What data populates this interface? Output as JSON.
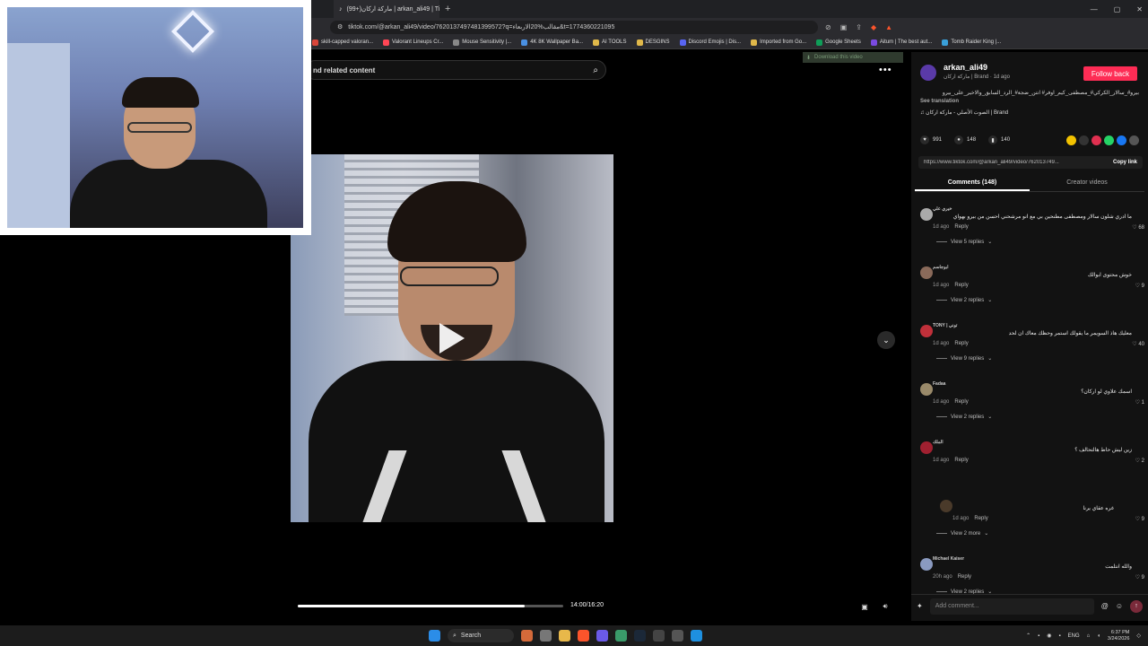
{
  "browser": {
    "tab_title": "(99+)ماركة اركان | arkan_ali49 | TikTok",
    "url": "tiktok.com/@arkan_ali49/video/7620137497481399572?q=مقالب%20الاربعاء&t=1774360221095",
    "new_tab": "+",
    "bookmarks": [
      {
        "label": "skill-capped valoran...",
        "color": "#d9463a"
      },
      {
        "label": "Valorant Lineups Cr...",
        "color": "#ff4655"
      },
      {
        "label": "Mouse Sensitivity |...",
        "color": "#888888"
      },
      {
        "label": "4K 8K Wallpaper Ba...",
        "color": "#4a90e2"
      },
      {
        "label": "AI TOOLS",
        "color": "#e0b84a"
      },
      {
        "label": "DESGINS",
        "color": "#e0b84a"
      },
      {
        "label": "Discord Emojis | Dis...",
        "color": "#5865f2"
      },
      {
        "label": "Imported from Go...",
        "color": "#e0b84a"
      },
      {
        "label": "Google Sheets",
        "color": "#0f9d58"
      },
      {
        "label": "Aitum | The best aut...",
        "color": "#7a4ae0"
      },
      {
        "label": "Tomb Raider King |...",
        "color": "#3aa0d9"
      }
    ]
  },
  "video": {
    "search_label": "nd related content",
    "time": "14:00/16:20",
    "progress_fraction": 0.855,
    "download_badge": "Download this video"
  },
  "post": {
    "author": "arkan_ali49",
    "author_sub": "ماركة اركان | Brand · 1d ago",
    "follow_label": "Follow back",
    "description": "بيرو#_سالار_الكركي#_مصطفى_كيم_اوفر# انتن_ضجة#_الرد_السابق_والاخير_على_بيرو",
    "see_translation": "See translation",
    "music": "الصوت الأصلي - ماركة اركان | Brand",
    "likes": "991",
    "comments_count": "148",
    "saves": "140",
    "link": "https://www.tiktok.com/@arkan_ali49/video/762013749...",
    "copy_link": "Copy link",
    "tabs": [
      "Comments (148)",
      "Creator videos"
    ]
  },
  "comments": [
    {
      "user": "خيري علي",
      "text": "ما ادري شلون سالار ومصطفى مطنحين بي مع انو مرشحني احسن من بيرو بهواي",
      "age": "1d ago",
      "reply": "Reply",
      "likes": "68",
      "view": "View 5 replies",
      "avatar_color": "#aaaaaa",
      "nested": false
    },
    {
      "user": "ابوجاسم",
      "text": "خوش محتوى ابوالك",
      "age": "1d ago",
      "reply": "Reply",
      "likes": "9",
      "view": "View 2 replies",
      "avatar_color": "#8a6a5a",
      "nested": false
    },
    {
      "user": "TONY | توني",
      "text": "معليك هاذ السويمر ما يقولك استمر وحظك معاك ان لحد",
      "age": "1d ago",
      "reply": "Reply",
      "likes": "40",
      "view": "View 9 replies",
      "avatar_color": "#c0303a",
      "nested": false
    },
    {
      "user": "Fadaa",
      "text": "اسمك علاوي لو اركان؟",
      "age": "1d ago",
      "reply": "Reply",
      "likes": "1",
      "view": "View 2 replies",
      "avatar_color": "#9a8a6a",
      "nested": false
    },
    {
      "user": "الملك",
      "text": "زين ليش حاط هالتحالف ؟",
      "age": "1d ago",
      "reply": "Reply",
      "likes": "2",
      "view": "",
      "avatar_color": "#a02030",
      "nested": false
    },
    {
      "user": "",
      "text": "غره عقاي يرنا",
      "age": "1d ago",
      "reply": "Reply",
      "likes": "9",
      "view": "View 2 more",
      "avatar_color": "#4a3a2a",
      "nested": true
    },
    {
      "user": "Michael Kaiser",
      "text": "والله انتلمت",
      "age": "20h ago",
      "reply": "Reply",
      "likes": "9",
      "view": "View 2 replies",
      "avatar_color": "#8a9ac0",
      "nested": false
    }
  ],
  "add_comment": {
    "placeholder": "Add comment..."
  },
  "taskbar": {
    "search": "Search",
    "lang": "ENG",
    "time": "6:37 PM",
    "date": "3/24/2026"
  }
}
